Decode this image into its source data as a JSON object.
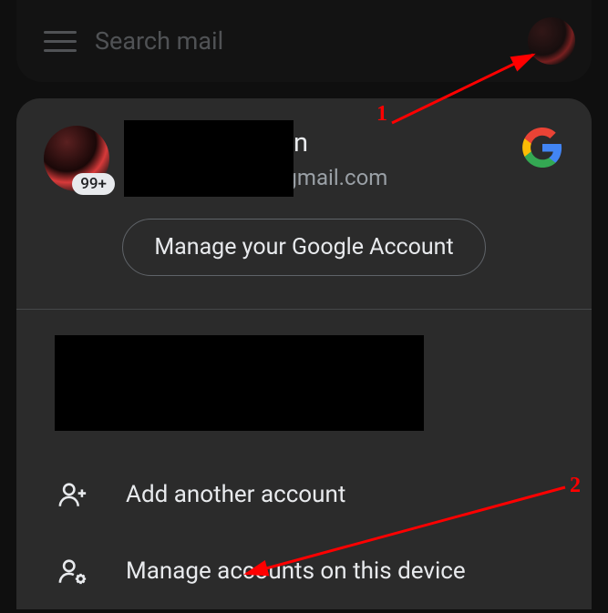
{
  "search": {
    "placeholder": "Search mail"
  },
  "account": {
    "name": "                      an",
    "email": "                        @gmail.com",
    "badge": "99+",
    "manage_button": "Manage your Google Account"
  },
  "actions": {
    "add_account": "Add another account",
    "manage_devices": "Manage accounts on this device"
  },
  "annotations": {
    "marker1": "1",
    "marker2": "2"
  }
}
